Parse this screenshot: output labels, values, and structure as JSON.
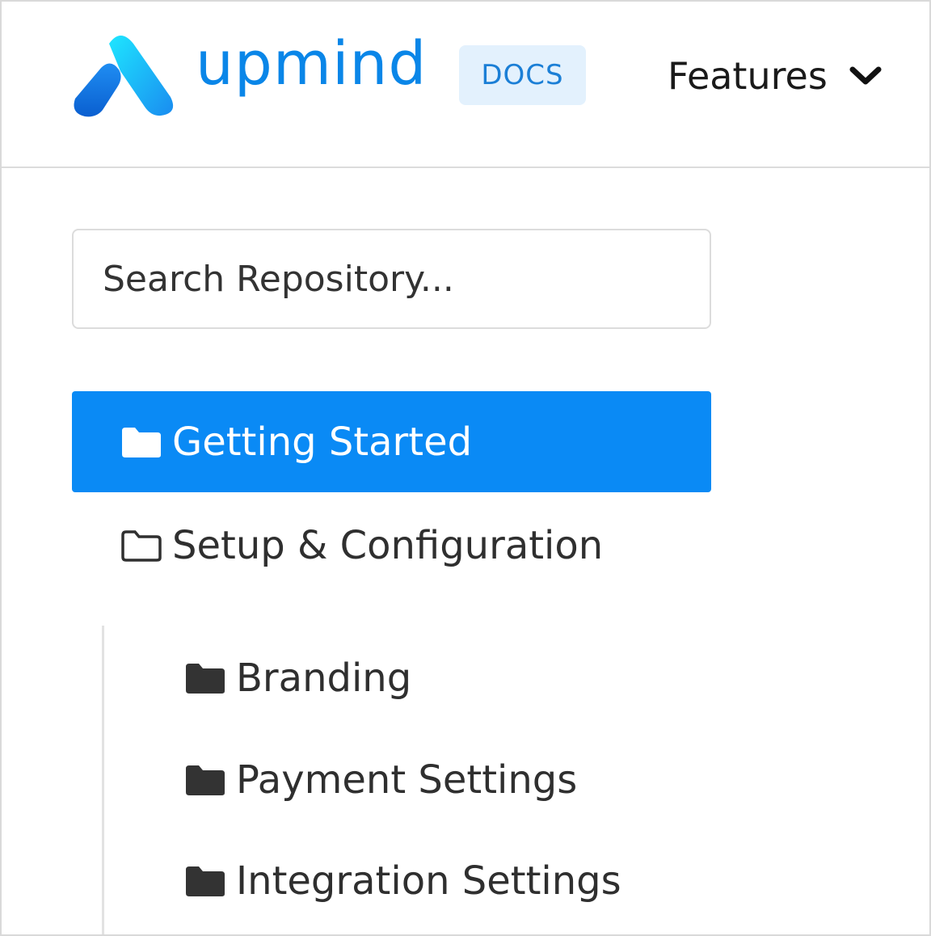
{
  "header": {
    "brand": "upmind",
    "badge": "DOCS",
    "nav_features": "Features",
    "brand_color": "#0a86e8"
  },
  "search": {
    "placeholder": "Search Repository..."
  },
  "sidebar": {
    "active_color": "#0a8af5",
    "items": [
      {
        "label": "Getting Started",
        "icon": "folder-icon",
        "active": true
      },
      {
        "label": "Setup & Configuration",
        "icon": "folder-outline-icon",
        "active": false,
        "children": [
          {
            "label": "Branding",
            "icon": "folder-icon"
          },
          {
            "label": "Payment Settings",
            "icon": "folder-icon"
          },
          {
            "label": "Integration Settings",
            "icon": "folder-icon"
          }
        ]
      }
    ]
  }
}
